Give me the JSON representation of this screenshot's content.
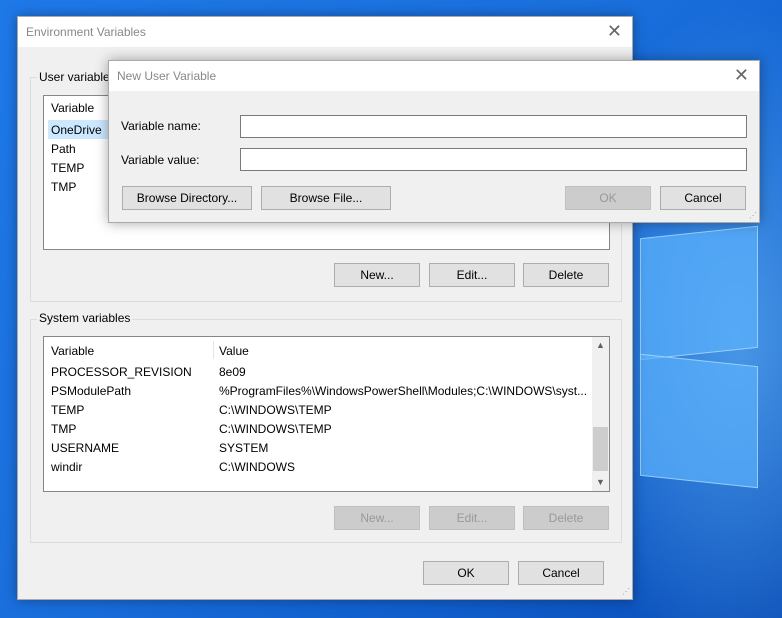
{
  "env_dialog": {
    "title": "Environment Variables",
    "user_group_label": "User variables",
    "user_columns": [
      "Variable"
    ],
    "user_rows": [
      {
        "variable": "OneDrive",
        "selected": true
      },
      {
        "variable": "Path"
      },
      {
        "variable": "TEMP"
      },
      {
        "variable": "TMP"
      }
    ],
    "user_buttons": {
      "new": "New...",
      "edit": "Edit...",
      "delete": "Delete"
    },
    "system_group_label": "System variables",
    "system_columns": [
      "Variable",
      "Value"
    ],
    "system_rows": [
      {
        "variable": "PROCESSOR_REVISION",
        "value": "8e09"
      },
      {
        "variable": "PSModulePath",
        "value": "%ProgramFiles%\\WindowsPowerShell\\Modules;C:\\WINDOWS\\syst..."
      },
      {
        "variable": "TEMP",
        "value": "C:\\WINDOWS\\TEMP"
      },
      {
        "variable": "TMP",
        "value": "C:\\WINDOWS\\TEMP"
      },
      {
        "variable": "USERNAME",
        "value": "SYSTEM"
      },
      {
        "variable": "windir",
        "value": "C:\\WINDOWS"
      }
    ],
    "system_buttons": {
      "new": "New...",
      "edit": "Edit...",
      "delete": "Delete"
    },
    "ok": "OK",
    "cancel": "Cancel"
  },
  "new_var_dialog": {
    "title": "New User Variable",
    "name_label": "Variable name:",
    "name_value": "",
    "value_label": "Variable value:",
    "value_value": "",
    "browse_dir": "Browse Directory...",
    "browse_file": "Browse File...",
    "ok": "OK",
    "cancel": "Cancel"
  },
  "icons": {
    "close": "close-icon",
    "scroll_up": "chevron-up-icon",
    "scroll_down": "chevron-down-icon",
    "resize": "resize-grip-icon"
  },
  "colors": {
    "desktop": "#1a6fdc",
    "selection": "#cce8ff",
    "default_button_border": "#0078d7"
  }
}
